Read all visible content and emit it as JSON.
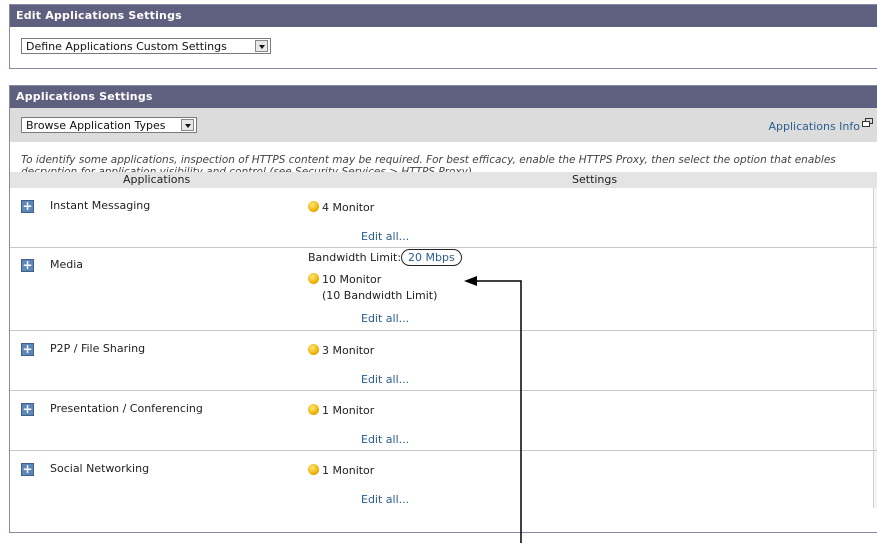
{
  "edit_panel": {
    "title": "Edit Applications Settings",
    "select_value": "Define Applications Custom Settings"
  },
  "apps_panel": {
    "title": "Applications Settings",
    "browse_select": "Browse Application Types",
    "info_link": "Applications Info",
    "note": "To identify some applications, inspection of HTTPS content may be required. For best efficacy, enable the HTTPS Proxy, then select the option that enables decryption for application visibility and control (see Security Services > HTTPS Proxy).",
    "col_applications": "Applications",
    "col_settings": "Settings",
    "edit_all": "Edit all...",
    "rows": [
      {
        "name": "Instant Messaging",
        "monitor": "4 Monitor"
      },
      {
        "name": "Media",
        "bandwidth_label": "Bandwidth Limit:",
        "bandwidth_value": "20 Mbps",
        "monitor": "10 Monitor",
        "monitor_sub": "(10 Bandwidth Limit)"
      },
      {
        "name": "P2P / File Sharing",
        "monitor": "3 Monitor"
      },
      {
        "name": "Presentation / Conferencing",
        "monitor": "1 Monitor"
      },
      {
        "name": "Social Networking",
        "monitor": "1 Monitor"
      }
    ]
  },
  "colors": {
    "title_bar": "#5f607f",
    "link": "#2a5d8f",
    "toolbar": "#dcdcdc"
  }
}
